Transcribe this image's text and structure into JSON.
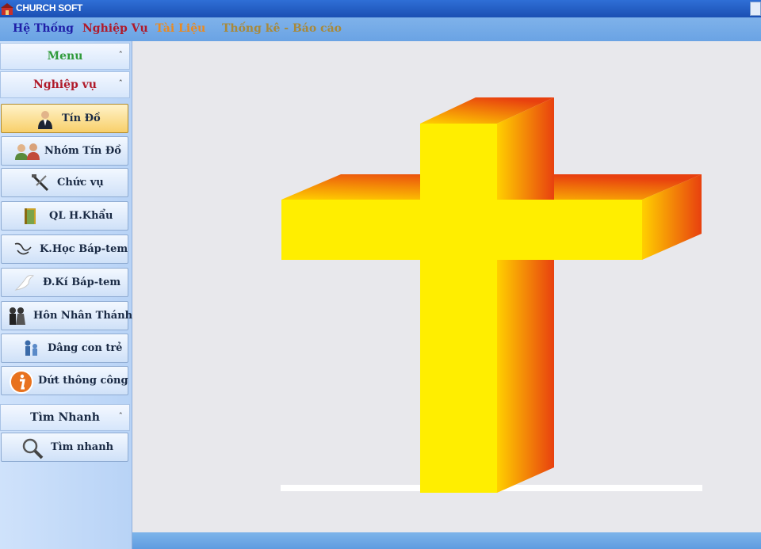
{
  "window": {
    "title": "CHURCH SOFT"
  },
  "menubar": {
    "items": [
      {
        "label": "Hệ Thống",
        "color": "#1f1fa8"
      },
      {
        "label": "Nghiệp Vụ",
        "color": "#b01a2a"
      },
      {
        "label": "Tài Liệu",
        "color": "#e98a22"
      },
      {
        "label": "Thống kê - Báo cáo",
        "color": "#a8893a"
      }
    ]
  },
  "sidebar": {
    "menu_header": {
      "label": "Menu",
      "color": "#2f9a3a"
    },
    "nghiepvu_header": {
      "label": "Nghiệp vụ",
      "color": "#b01a2a"
    },
    "items": [
      {
        "label": "Tín Đồ",
        "icon": "person-icon"
      },
      {
        "label": "Nhóm Tín Đồ",
        "icon": "group-icon"
      },
      {
        "label": "Chức vụ",
        "icon": "tools-icon"
      },
      {
        "label": "QL  H.Khẩu",
        "icon": "book-icon"
      },
      {
        "label": "K.Học Báp-tem",
        "icon": "bird-sketch-icon"
      },
      {
        "label": "Đ.Kí Báp-tem",
        "icon": "dove-icon"
      },
      {
        "label": "Hôn Nhân Thánh",
        "icon": "couple-icon"
      },
      {
        "label": "Dâng con trẻ",
        "icon": "family-icon"
      },
      {
        "label": "Dứt thông công",
        "icon": "info-icon"
      }
    ],
    "active_index": 0,
    "timnhanh_header": {
      "label": "Tìm Nhanh",
      "color": "#1a2a44"
    },
    "search_item": {
      "label": "Tìm nhanh",
      "icon": "magnifier-icon"
    }
  },
  "colors": {
    "accent": "#1b4fb3",
    "cross_front": "#ffee00",
    "cross_side": "#e84a12"
  }
}
